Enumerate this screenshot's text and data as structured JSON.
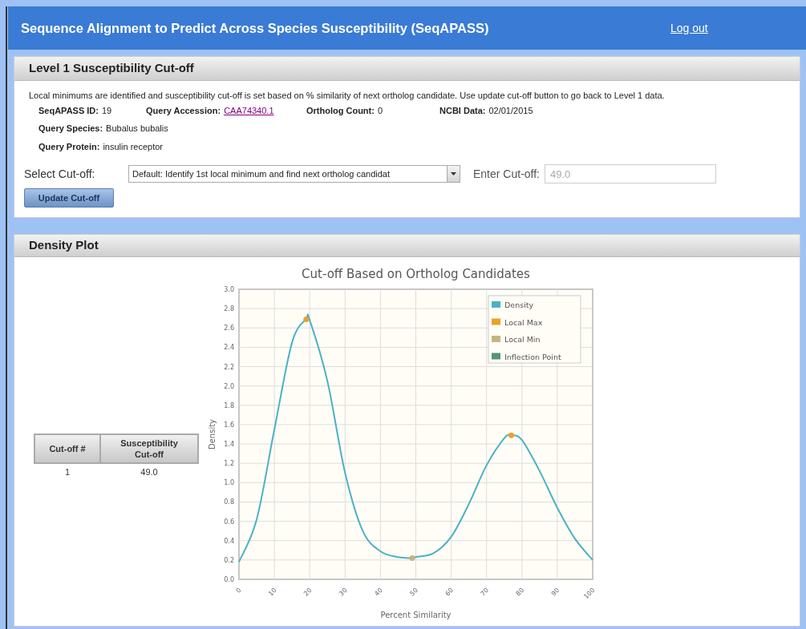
{
  "header": {
    "title": "Sequence Alignment to Predict Across Species Susceptibility (SeqAPASS)",
    "logout_link": "Log out"
  },
  "level1_panel": {
    "title": "Level 1 Susceptibility Cut-off",
    "description": "Local minimums are identified and susceptibility cut-off is set based on % similarity of next ortholog candidate. Use update cut-off button to go back to Level 1 data.",
    "info_row": [
      {
        "label": "SeqAPASS ID:",
        "value": "19",
        "kind": "text"
      },
      {
        "label": "Query Accession:",
        "value": "CAA74340.1",
        "kind": "link"
      },
      {
        "label": "Ortholog Count:",
        "value": "0",
        "kind": "text"
      },
      {
        "label": "NCBI Data:",
        "value": "02/01/2015",
        "kind": "text"
      }
    ],
    "details": [
      {
        "label": "Query Species:",
        "value": "Bubalus bubalis"
      },
      {
        "label": "Query Protein:",
        "value": "insulin receptor"
      }
    ],
    "select_label": "Select Cut-off:",
    "select_value": "Default: Identify 1st local minimum and find next ortholog candidat",
    "cutoff_label": "Enter Cut-off:",
    "cutoff_field": {
      "placeholder": "49.0"
    },
    "update_button": "Update Cut-off"
  },
  "density_panel": {
    "title": "Density Plot",
    "table": {
      "columns": [
        "Cut-off #",
        "Susceptibility Cut-off"
      ],
      "rows": [
        [
          "1",
          "49.0"
        ]
      ]
    },
    "chart_data": {
      "type": "line",
      "title": "Cut-off Based on Ortholog Candidates",
      "xlabel": "Percent Similarity",
      "ylabel": "Density",
      "x": [
        0,
        5,
        10,
        15,
        19,
        20,
        25,
        30,
        35,
        40,
        45,
        49,
        50,
        55,
        60,
        65,
        70,
        75,
        77,
        80,
        85,
        90,
        95,
        100
      ],
      "xlim": [
        0,
        100
      ],
      "ylim": [
        0,
        3
      ],
      "grid": true,
      "xticks": [
        0,
        10,
        20,
        30,
        40,
        50,
        60,
        70,
        80,
        90,
        100
      ],
      "yticks": [
        {
          "value": 0,
          "label": "0.0"
        },
        {
          "value": 0.2,
          "label": "0.2"
        },
        {
          "value": 0.4,
          "label": "0.4"
        },
        {
          "value": 0.6,
          "label": "0.6"
        },
        {
          "value": 0.8,
          "label": "0.8"
        },
        {
          "value": 1,
          "label": "1.0"
        },
        {
          "value": 1.2,
          "label": "1.2"
        },
        {
          "value": 1.4,
          "label": "1.4"
        },
        {
          "value": 1.6,
          "label": "1.6"
        },
        {
          "value": 1.8,
          "label": "1.8"
        },
        {
          "value": 2,
          "label": "2.0"
        },
        {
          "value": 2.2,
          "label": "2.2"
        },
        {
          "value": 2.4,
          "label": "2.4"
        },
        {
          "value": 2.6,
          "label": "2.6"
        },
        {
          "value": 2.8,
          "label": "2.8"
        },
        {
          "value": 3,
          "label": "3.0"
        }
      ],
      "series": [
        {
          "name": "Density",
          "color": "#4bb2c5",
          "values": [
            0.18,
            0.62,
            1.55,
            2.45,
            2.69,
            2.68,
            2.05,
            1.1,
            0.5,
            0.29,
            0.23,
            0.22,
            0.23,
            0.27,
            0.44,
            0.78,
            1.18,
            1.46,
            1.49,
            1.44,
            1.12,
            0.74,
            0.42,
            0.2
          ]
        }
      ]
    },
    "point_legend": [
      {
        "label": "Local Max",
        "kind": "max",
        "color": "#eaa228"
      },
      {
        "label": "Local Min",
        "kind": "min",
        "color": "#c5b47f"
      },
      {
        "label": "Inflection Point",
        "kind": "inflection",
        "color": "#579575"
      }
    ]
  }
}
